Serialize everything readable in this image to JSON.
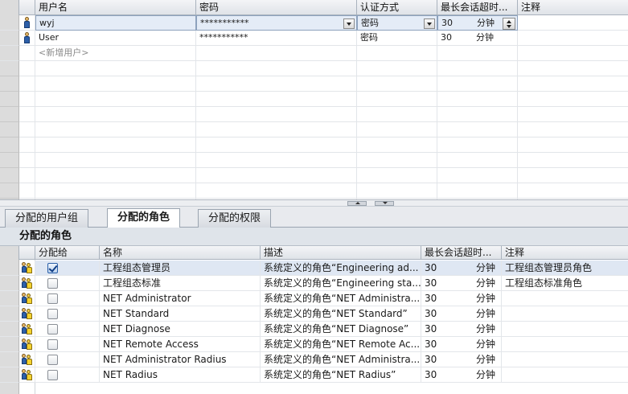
{
  "users_table": {
    "columns": [
      "用户名",
      "密码",
      "认证方式",
      "最长会话超时...",
      "注释"
    ],
    "rows": [
      {
        "username": "wyj",
        "password": "***********",
        "auth": "密码",
        "timeout": "30",
        "unit": "分钟",
        "comment": "",
        "selected": true
      },
      {
        "username": "User",
        "password": "***********",
        "auth": "密码",
        "timeout": "30",
        "unit": "分钟",
        "comment": "",
        "selected": false
      }
    ],
    "add_user_placeholder": "<新增用户>"
  },
  "tabs": [
    {
      "label": "分配的用户组",
      "active": false
    },
    {
      "label": "分配的角色",
      "active": true
    },
    {
      "label": "分配的权限",
      "active": false
    }
  ],
  "roles_panel": {
    "title": "分配的角色",
    "columns": [
      "分配给",
      "名称",
      "描述",
      "最长会话超时...",
      "注释"
    ],
    "rows": [
      {
        "assigned": true,
        "name": "工程组态管理员",
        "description": "系统定义的角色“Engineering ad...",
        "timeout": "30",
        "unit": "分钟",
        "comment": "工程组态管理员角色",
        "selected": true
      },
      {
        "assigned": false,
        "name": "工程组态标准",
        "description": "系统定义的角色“Engineering sta...",
        "timeout": "30",
        "unit": "分钟",
        "comment": "工程组态标准角色",
        "selected": false
      },
      {
        "assigned": false,
        "name": "NET Administrator",
        "description": "系统定义的角色“NET Administra...",
        "timeout": "30",
        "unit": "分钟",
        "comment": "",
        "selected": false
      },
      {
        "assigned": false,
        "name": "NET Standard",
        "description": "系统定义的角色“NET Standard”",
        "timeout": "30",
        "unit": "分钟",
        "comment": "",
        "selected": false
      },
      {
        "assigned": false,
        "name": "NET Diagnose",
        "description": "系统定义的角色“NET Diagnose”",
        "timeout": "30",
        "unit": "分钟",
        "comment": "",
        "selected": false
      },
      {
        "assigned": false,
        "name": "NET Remote Access",
        "description": "系统定义的角色“NET Remote Ac...",
        "timeout": "30",
        "unit": "分钟",
        "comment": "",
        "selected": false
      },
      {
        "assigned": false,
        "name": "NET Administrator Radius",
        "description": "系统定义的角色“NET Administra...",
        "timeout": "30",
        "unit": "分钟",
        "comment": "",
        "selected": false
      },
      {
        "assigned": false,
        "name": "NET Radius",
        "description": "系统定义的角色“NET Radius”",
        "timeout": "30",
        "unit": "分钟",
        "comment": "",
        "selected": false
      }
    ]
  },
  "colors": {
    "selection": "#d9e4f2",
    "header": "#dfe3e8",
    "gutter": "#dcdcdc",
    "accent": "#2d5fa8"
  }
}
